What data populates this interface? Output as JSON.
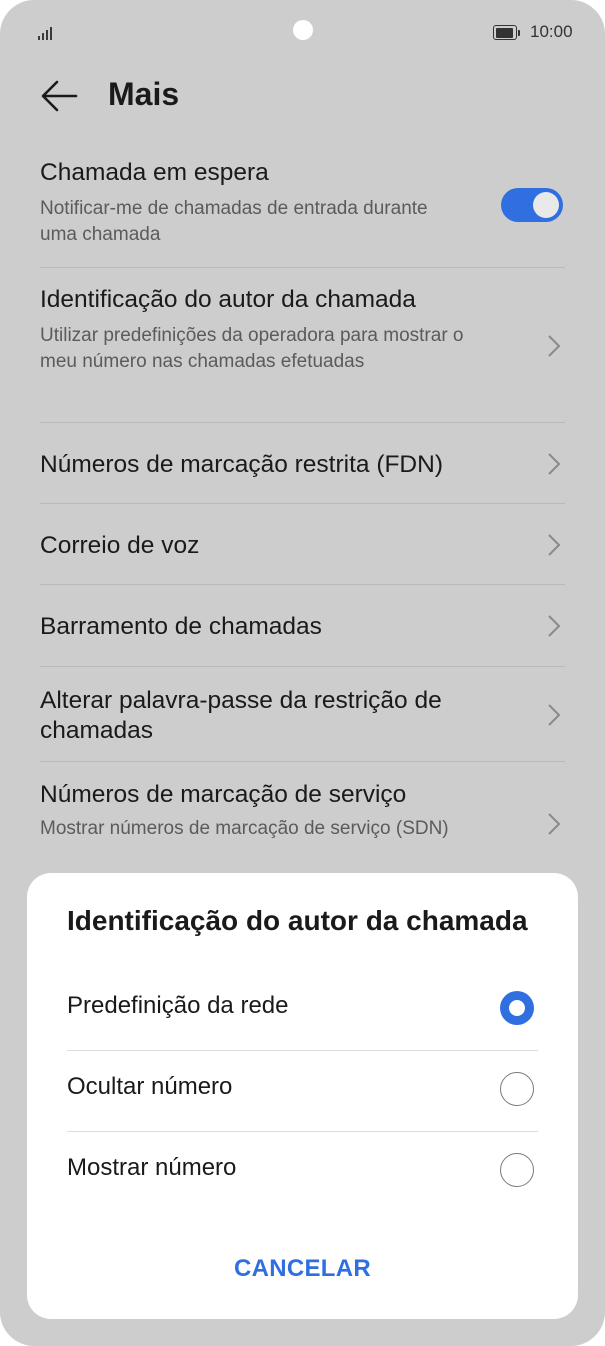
{
  "status_bar": {
    "time": "10:00",
    "signal_icon": "signal-icon",
    "battery_icon": "battery-icon"
  },
  "header": {
    "title": "Mais",
    "back_icon": "arrow-left-icon"
  },
  "settings": {
    "items": [
      {
        "title": "Chamada em espera",
        "subtitle": "Notificar-me de chamadas de entrada durante uma chamada",
        "control": "toggle",
        "toggle_on": true
      },
      {
        "title": "Identificação do autor da chamada",
        "subtitle": "Utilizar predefinições da operadora para mostrar o meu número nas chamadas efetuadas",
        "control": "chevron"
      },
      {
        "title": "Números de marcação restrita (FDN)",
        "control": "chevron"
      },
      {
        "title": "Correio de voz",
        "control": "chevron"
      },
      {
        "title": "Barramento de chamadas",
        "control": "chevron"
      },
      {
        "title": "Alterar palavra-passe da restrição de chamadas",
        "control": "chevron"
      },
      {
        "title": "Números de marcação de serviço",
        "subtitle": "Mostrar números de marcação de serviço (SDN)",
        "control": "chevron"
      }
    ]
  },
  "dialog": {
    "title": "Identificação do autor da chamada",
    "options": [
      {
        "label": "Predefinição da rede",
        "selected": true
      },
      {
        "label": "Ocultar número",
        "selected": false
      },
      {
        "label": "Mostrar número",
        "selected": false
      }
    ],
    "cancel_label": "CANCELAR"
  },
  "colors": {
    "accent": "#2f6fe0",
    "scrim_background": "#cdcdcd",
    "dialog_background": "#ffffff"
  }
}
